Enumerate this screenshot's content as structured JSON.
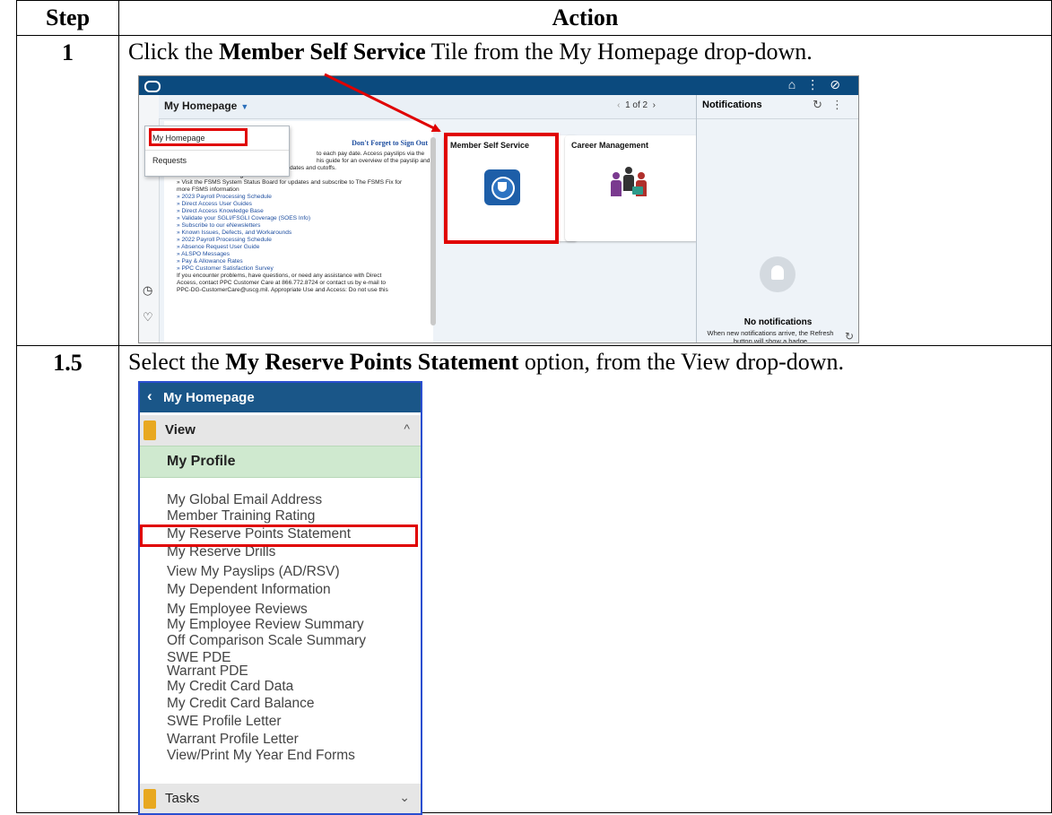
{
  "table": {
    "header_step": "Step",
    "header_action": "Action"
  },
  "rows": [
    {
      "step": "1",
      "pre": "Click the ",
      "bold": "Member Self Service",
      "post": " Tile from the My Homepage drop-down."
    },
    {
      "step": "1.5",
      "pre": "Select the ",
      "bold": "My Reserve Points Statement",
      "post": " option, from the View drop-down."
    }
  ],
  "shot1": {
    "homepage_title": "My Homepage",
    "paging": "1 of 2",
    "notifications_title": "Notifications",
    "no_notifications": "No notifications",
    "notifications_message": "When new notifications arrive, the Refresh button will show a badge",
    "dropdown": [
      "My Homepage",
      "Requests"
    ],
    "news_signout": "Don't Forget to Sign Out",
    "news_lines": [
      "to each pay date.  Access payslips via the",
      "his guide for an overview of the payslip and",
      "to the Payroll Processing Schedule for pay dates and cutoffs.",
      "FSMS Scheduled Outages",
      "» Visit the  FSMS System Status Board for updates and subscribe to The FSMS Fix for",
      "more FSMS information",
      "» 2023 Payroll Processing Schedule",
      "» Direct Access User Guides",
      "» Direct Access Knowledge Base",
      "» Validate your SGLI/FSGLI Coverage (SOES Info)",
      "» Subscribe to our eNewsletters",
      "» Known Issues, Defects, and Workarounds",
      "» 2022 Payroll Processing Schedule",
      "» Absence Request User Guide",
      "» ALSPO Messages",
      "» Pay & Allowance Rates",
      "» PPC Customer Satisfaction Survey",
      "If you encounter problems, have questions, or need any assistance with Direct",
      "Access, contact PPC Customer Care at 866.772.8724 or contact us by e-mail to",
      "PPC-DG-CustomerCare@uscg.mil. Appropriate Use and Access: Do not use this"
    ],
    "tiles": [
      "Member Self Service",
      "Career Management"
    ],
    "colors": {
      "topbar": "#0b4a7e",
      "highlight": "#e00000",
      "link": "#1f4fa0"
    }
  },
  "shot2": {
    "header": "My Homepage",
    "view_label": "View",
    "profile_label": "My Profile",
    "items": [
      "My Global Email Address",
      "Member Training Rating",
      "My Reserve Points Statement",
      "My Reserve Drills",
      "View My Payslips (AD/RSV)",
      "My Dependent Information",
      "My Employee Reviews",
      "My Employee Review Summary",
      "Off Comparison Scale Summary",
      "SWE PDE",
      "Warrant PDE",
      "My Credit Card Data",
      "My Credit Card Balance",
      "SWE Profile Letter",
      "Warrant Profile Letter",
      "View/Print My Year End Forms"
    ],
    "tasks_label": "Tasks",
    "colors": {
      "header": "#1a5688",
      "profile_bg": "#cfe9cf",
      "border": "#2a4fd0"
    }
  }
}
